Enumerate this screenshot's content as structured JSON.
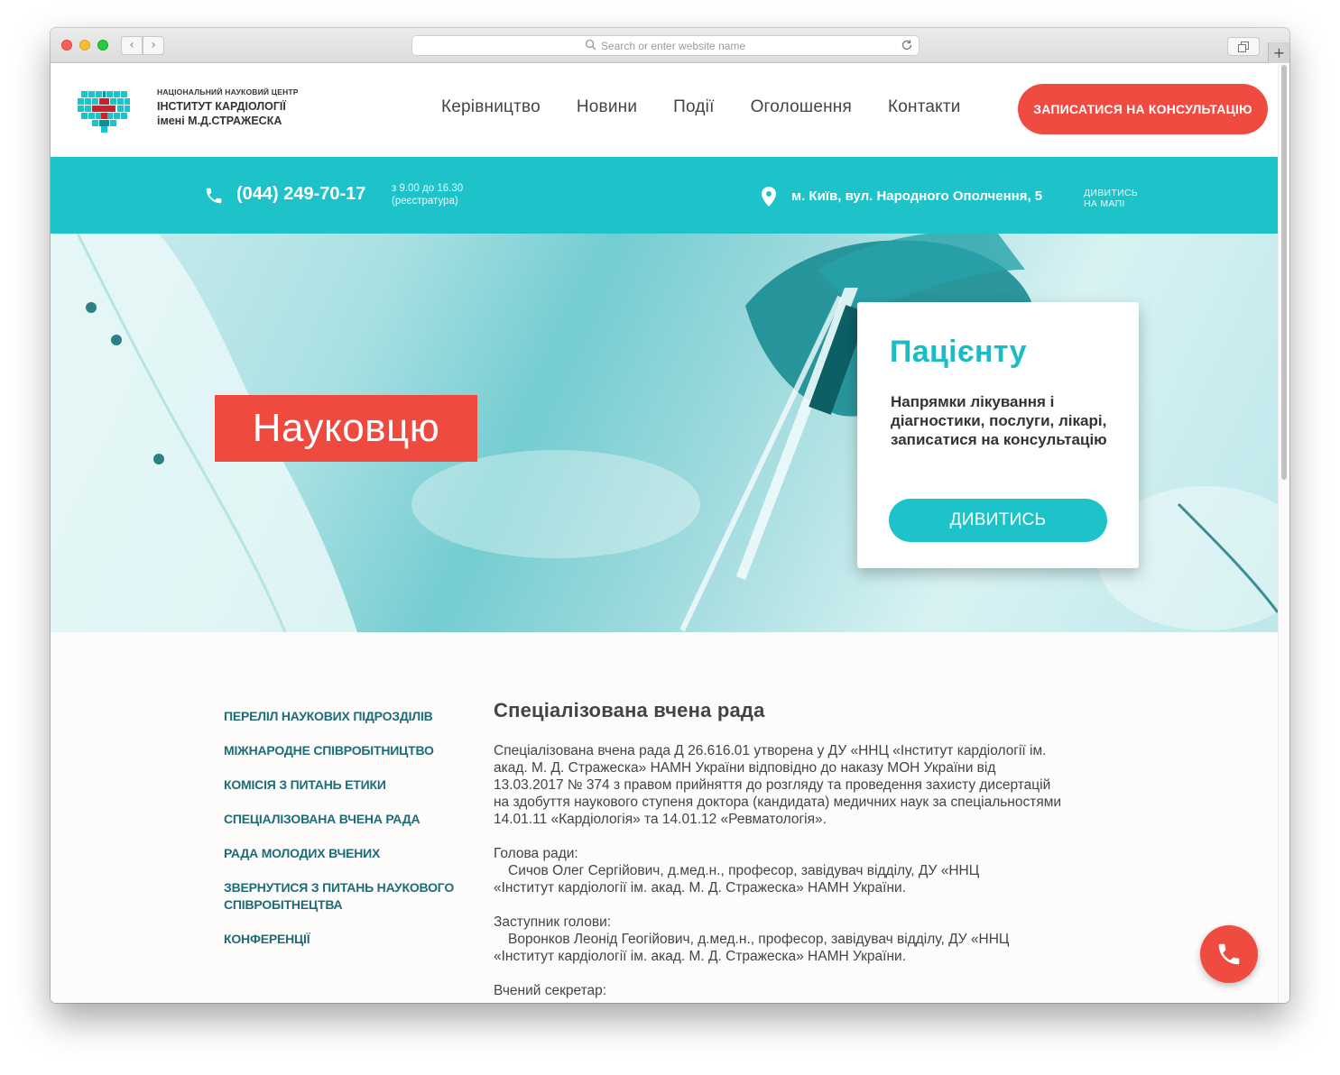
{
  "browser": {
    "url_placeholder": "Search or enter website name",
    "back_glyph": "‹",
    "forward_glyph": "›",
    "new_tab_glyph": "+"
  },
  "header": {
    "logo_sub": "НАЦІОНАЛЬНИЙ НАУКОВИЙ ЦЕНТР",
    "logo_line1": "ІНСТИТУТ КАРДІОЛОГІЇ",
    "logo_line2": "імені М.Д.СТРАЖЕСКА",
    "nav": [
      "Керівництво",
      "Новини",
      "Події",
      "Оголошення",
      "Контакти"
    ],
    "cta_label": "ЗАПИСАТИСЯ НА КОНСУЛЬТАЦІЮ"
  },
  "infobar": {
    "phone": "(044) 249-70-17",
    "hours_line1": "з 9.00 до 16.30",
    "hours_line2": "(реєстратура)",
    "address": "м. Київ, вул. Народного Ополчення, 5",
    "map_line1": "ДИВИТИСЬ",
    "map_line2": "НА МАПІ"
  },
  "hero": {
    "tag": "Науковцю",
    "card_title": "Пацієнту",
    "card_text": "Напрямки лікування і діагностики, послуги, лікарі, записатися на консультацію",
    "card_button": "ДИВИТИСЬ"
  },
  "sidebar": {
    "items": [
      "ПЕРЕЛІЛ НАУКОВИХ ПІДРОЗДІЛІВ",
      "МІЖНАРОДНЕ СПІВРОБІТНИЦТВО",
      "КОМІСІЯ З ПИТАНЬ ЕТИКИ",
      "СПЕЦІАЛІЗОВАНА ВЧЕНА РАДА",
      "РАДА МОЛОДИХ ВЧЕНИХ",
      "ЗВЕРНУТИСЯ З ПИТАНЬ НАУКОВОГО СПІВРОБІТНЕЦТВА",
      "КОНФЕРЕНЦІЇ"
    ]
  },
  "article": {
    "title": "Спеціалізована вчена рада",
    "intro": "Спеціалізована вчена рада Д 26.616.01 утворена у ДУ «ННЦ «Інститут кардіології ім. акад. М. Д. Стражеска» НАМН України відповідно до наказу МОН України від 13.03.2017 № 374 з правом прийняття до розгляду та проведення захисту дисертацій на здобуття наукового ступеня доктора (кандидата) медичних наук за спеціальностями 14.01.11 «Кардіологія» та 14.01.12 «Ревматологія».",
    "head_label": "Голова ради:",
    "head_name": "Сичов Олег Сергійович, д.мед.н., професор, завідувач відділу, ДУ «ННЦ",
    "head_org": "«Інститут кардіології ім. акад. М. Д. Стражеска» НАМН України.",
    "deputy_label": "Заступник голови:",
    "deputy_name": "Воронков Леонід Геогійович, д.мед.н., професор, завідувач відділу, ДУ «ННЦ",
    "deputy_org": "«Інститут кардіології ім. акад. М. Д. Стражеска» НАМН України.",
    "secretary_label": "Вчений секретар:"
  },
  "colors": {
    "accent_teal": "#1ec3c9",
    "accent_red": "#ef4b41",
    "nav_link": "#1d6c78"
  }
}
